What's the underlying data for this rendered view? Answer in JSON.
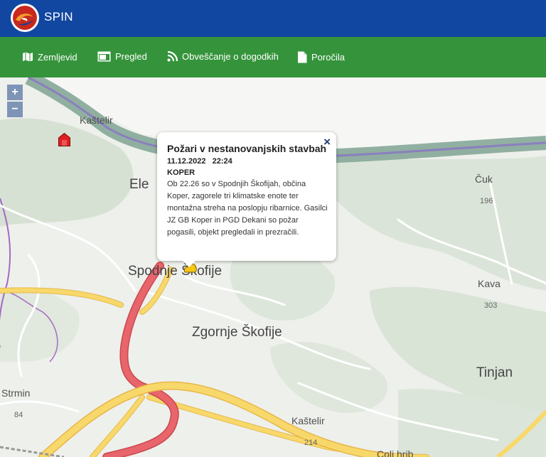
{
  "app": {
    "title": "SPIN",
    "logo_icon": "spin-logo"
  },
  "nav": {
    "items": [
      {
        "label": "Zemljevid",
        "icon": "map-icon"
      },
      {
        "label": "Pregled",
        "icon": "window-icon"
      },
      {
        "label": "Obveščanje o dogodkih",
        "icon": "rss-icon"
      },
      {
        "label": "Poročila",
        "icon": "document-icon"
      }
    ]
  },
  "map": {
    "zoom_in": "+",
    "zoom_out": "−",
    "places": {
      "kastelir_north": "Kaštelir",
      "eler": "Ele",
      "cuk": "Čuk",
      "spodnje_skofije": "Spodnje Škofije",
      "kava": "Kava",
      "zgornje_skofije": "Zgornje Škofije",
      "tinjan": "Tinjan",
      "strmin": "Strmin",
      "kastelir_south": "Kaštelir",
      "coli_hrib": "Coli hrib"
    },
    "elevations": {
      "cuk": "196",
      "kava": "303",
      "strmin": "84",
      "kastelir_south": "214"
    },
    "colors": {
      "motorway": "#e8656b",
      "main_road": "#f8d86a",
      "border": "#8a7fbf",
      "border_band": "#7fa393"
    }
  },
  "popup": {
    "title": "Požari v nestanovanjskih stavbah",
    "date": "11.12.2022   22:24",
    "location": "KOPER",
    "text": "Ob 22.26 so v Spodnjih Škofijah, občina Koper, zagorele tri klimatske enote ter montažna streha na poslopju ribarnice. Gasilci JZ GB Koper in PGD Dekani so požar pogasili, objekt pregledali in prezračili.",
    "close_label": "×"
  }
}
